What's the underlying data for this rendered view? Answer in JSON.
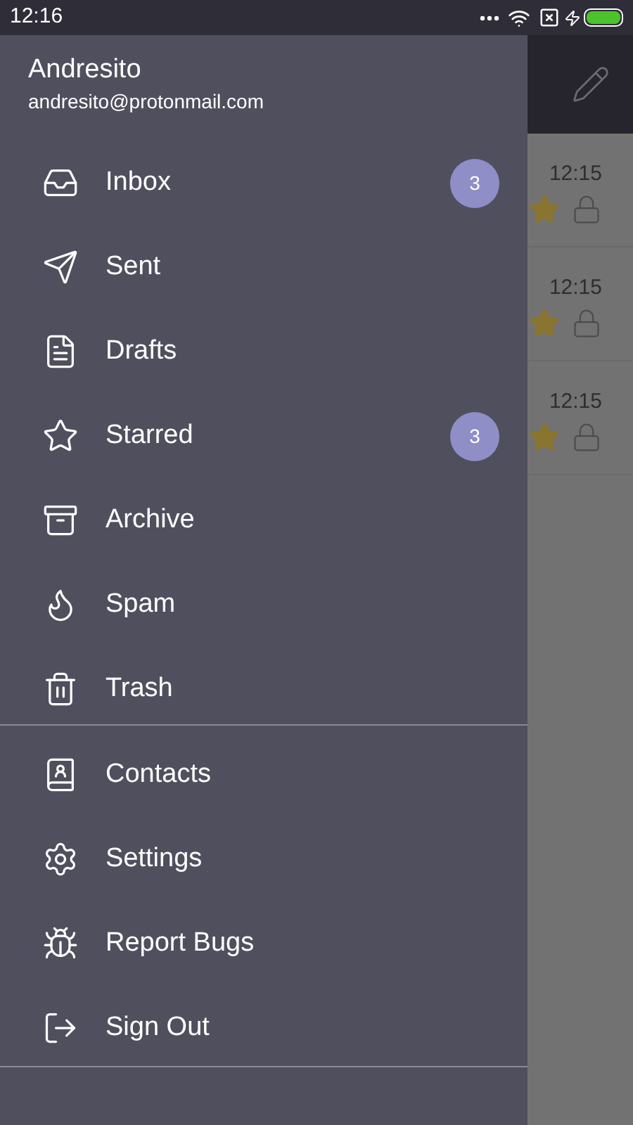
{
  "status_bar": {
    "time": "12:16"
  },
  "account": {
    "name": "Andresito",
    "email": "andresito@protonmail.com"
  },
  "folders": [
    {
      "label": "Inbox",
      "badge": "3"
    },
    {
      "label": "Sent"
    },
    {
      "label": "Drafts"
    },
    {
      "label": "Starred",
      "badge": "3"
    },
    {
      "label": "Archive"
    },
    {
      "label": "Spam"
    },
    {
      "label": "Trash"
    }
  ],
  "actions": [
    {
      "label": "Contacts"
    },
    {
      "label": "Settings"
    },
    {
      "label": "Report Bugs"
    },
    {
      "label": "Sign Out"
    }
  ],
  "messages": [
    {
      "time": "12:15",
      "starred": true
    },
    {
      "time": "12:15",
      "starred": true
    },
    {
      "time": "12:15",
      "starred": true
    }
  ]
}
